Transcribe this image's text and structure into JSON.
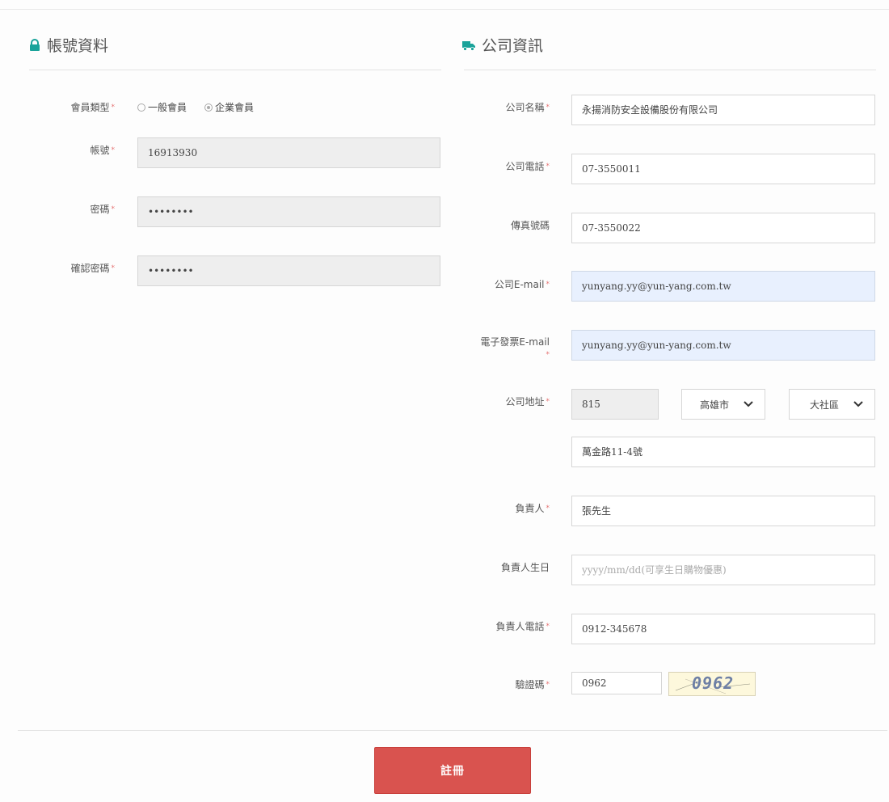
{
  "account": {
    "title": "帳號資料",
    "member_type_label": "會員類型",
    "member_type_options": [
      "一般會員",
      "企業會員"
    ],
    "member_type_selected": "企業會員",
    "account_label": "帳號",
    "account_value": "16913930",
    "password_label": "密碼",
    "password_value": "••••••••",
    "confirm_label": "確認密碼",
    "confirm_value": "••••••••"
  },
  "company": {
    "title": "公司資訊",
    "name_label": "公司名稱",
    "name_value": "永揚消防安全設備股份有限公司",
    "phone_label": "公司電話",
    "phone_value": "07-3550011",
    "fax_label": "傳真號碼",
    "fax_value": "07-3550022",
    "email_label": "公司E-mail",
    "email_value": "yunyang.yy@yun-yang.com.tw",
    "invoice_email_label": "電子發票E-mail",
    "invoice_email_value": "yunyang.yy@yun-yang.com.tw",
    "address_label": "公司地址",
    "zip_value": "815",
    "city_value": "高雄市",
    "district_value": "大社區",
    "street_value": "萬金路11-4號",
    "owner_label": "負責人",
    "owner_value": "張先生",
    "owner_birthday_label": "負責人生日",
    "owner_birthday_placeholder": "yyyy/mm/dd(可享生日購物優惠)",
    "owner_phone_label": "負責人電話",
    "owner_phone_value": "0912-345678",
    "captcha_label": "驗證碼",
    "captcha_input_value": "0962",
    "captcha_image_text": "0962"
  },
  "required_mark": "*",
  "submit_label": "註冊",
  "colors": {
    "accent": "#1aa39a",
    "submit": "#d9534f",
    "autofill": "#e8f0fe"
  },
  "icons": {
    "account_section": "lock-icon",
    "company_section": "truck-icon",
    "select_arrow": "chevron-down-icon"
  }
}
